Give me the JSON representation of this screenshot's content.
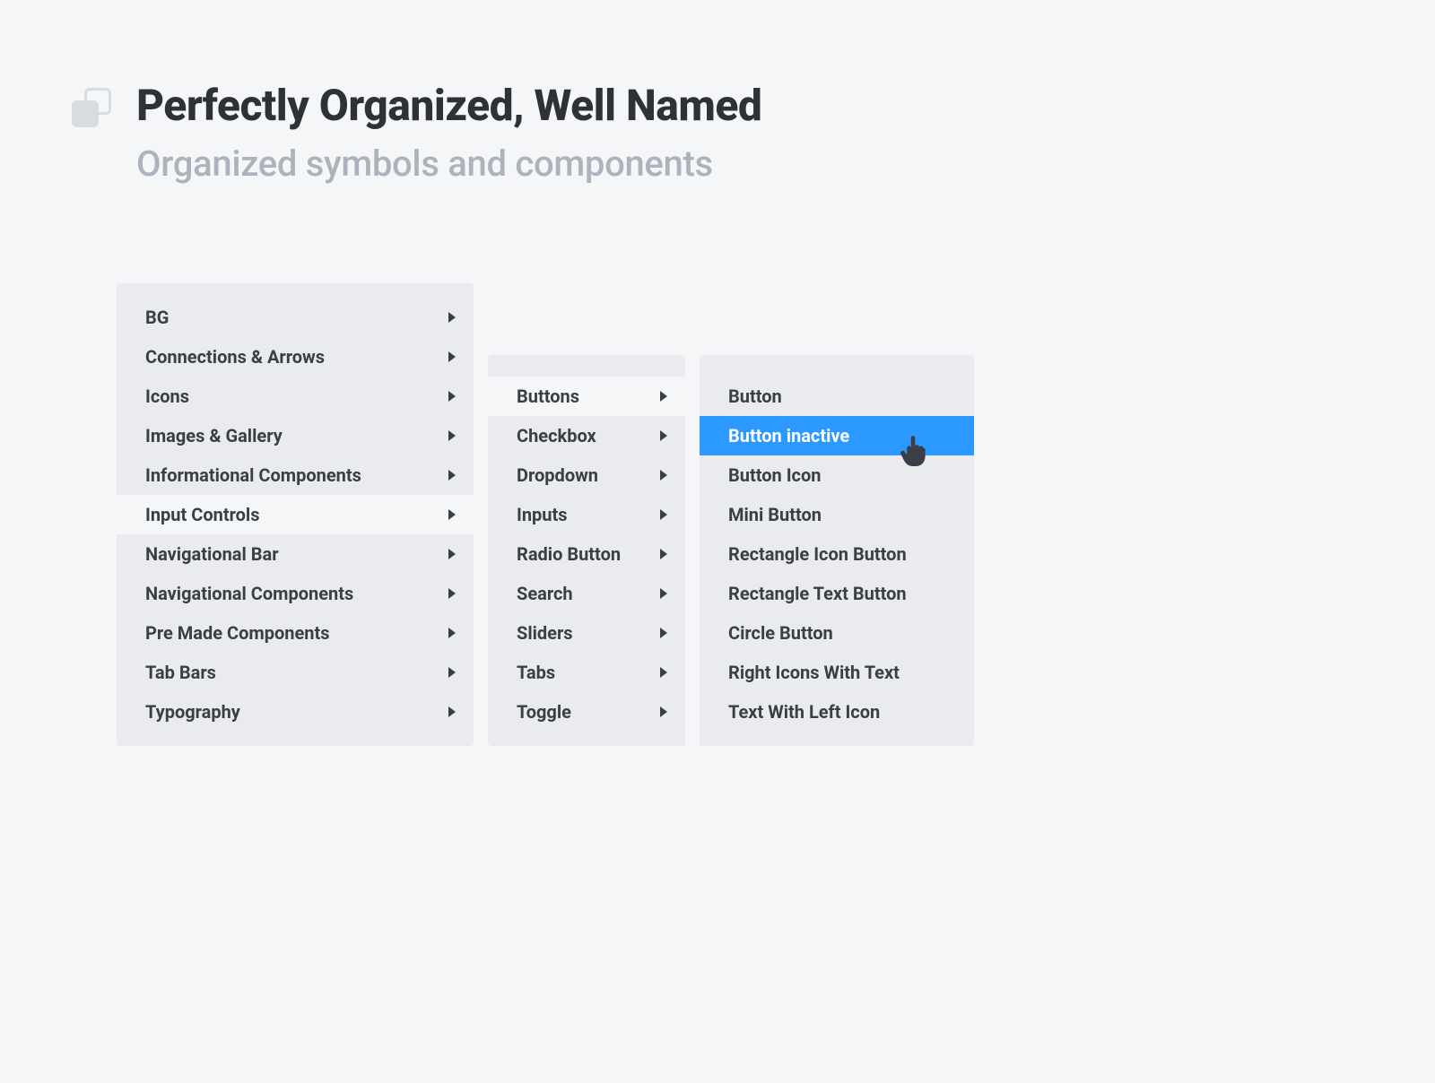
{
  "header": {
    "title": "Perfectly Organized, Well Named",
    "subtitle": "Organized symbols and components"
  },
  "menu1": {
    "items": [
      {
        "label": "BG",
        "hovered": false
      },
      {
        "label": "Connections & Arrows",
        "hovered": false
      },
      {
        "label": "Icons",
        "hovered": false
      },
      {
        "label": "Images & Gallery",
        "hovered": false
      },
      {
        "label": "Informational Components",
        "hovered": false
      },
      {
        "label": "Input Controls",
        "hovered": true
      },
      {
        "label": "Navigational Bar",
        "hovered": false
      },
      {
        "label": "Navigational Components",
        "hovered": false
      },
      {
        "label": "Pre Made Components",
        "hovered": false
      },
      {
        "label": "Tab Bars",
        "hovered": false
      },
      {
        "label": "Typography",
        "hovered": false
      }
    ]
  },
  "menu2": {
    "items": [
      {
        "label": "Buttons",
        "hovered": true
      },
      {
        "label": "Checkbox",
        "hovered": false
      },
      {
        "label": "Dropdown",
        "hovered": false
      },
      {
        "label": "Inputs",
        "hovered": false
      },
      {
        "label": "Radio Button",
        "hovered": false
      },
      {
        "label": "Search",
        "hovered": false
      },
      {
        "label": "Sliders",
        "hovered": false
      },
      {
        "label": "Tabs",
        "hovered": false
      },
      {
        "label": "Toggle",
        "hovered": false
      }
    ]
  },
  "menu3": {
    "items": [
      {
        "label": "Button",
        "selected": false
      },
      {
        "label": "Button inactive",
        "selected": true
      },
      {
        "label": "Button Icon",
        "selected": false
      },
      {
        "label": "Mini Button",
        "selected": false
      },
      {
        "label": "Rectangle Icon Button",
        "selected": false
      },
      {
        "label": "Rectangle Text Button",
        "selected": false
      },
      {
        "label": "Circle Button",
        "selected": false
      },
      {
        "label": "Right Icons With Text",
        "selected": false
      },
      {
        "label": "Text With Left Icon",
        "selected": false
      }
    ]
  },
  "colors": {
    "background": "#f5f6f8",
    "panel": "#e9ebee",
    "text": "#3a3f47",
    "muted": "#adb3bd",
    "accent": "#2b99ff"
  }
}
